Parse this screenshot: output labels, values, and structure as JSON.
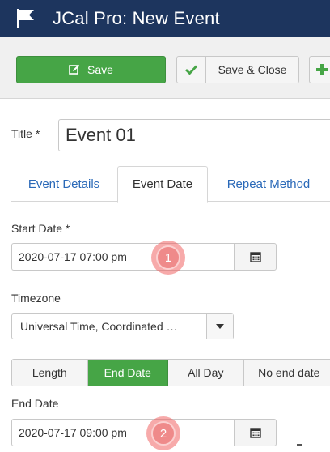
{
  "header": {
    "title": "JCal Pro: New Event",
    "logo_icon": "flag-icon"
  },
  "toolbar": {
    "save_label": "Save",
    "save_close_label": "Save & Close",
    "save_color": "#46a546"
  },
  "title_field": {
    "label": "Title *",
    "value": "Event 01"
  },
  "tabs": [
    {
      "label": "Event Details",
      "active": false
    },
    {
      "label": "Event Date",
      "active": true
    },
    {
      "label": "Repeat Method",
      "active": false
    }
  ],
  "start_date": {
    "label": "Start Date *",
    "value": "2020-07-17 07:00 pm"
  },
  "timezone": {
    "label": "Timezone",
    "value": "Universal Time, Coordinated …"
  },
  "end_options": {
    "items": [
      "Length",
      "End Date",
      "All Day",
      "No end date"
    ],
    "selected": "End Date"
  },
  "end_date": {
    "label": "End Date",
    "value": "2020-07-17 09:00 pm"
  },
  "markers": [
    "1",
    "2"
  ],
  "colors": {
    "header": "#1d355e",
    "accent": "#46a546",
    "link": "#2a69b8",
    "marker": "#ef8a8a"
  }
}
